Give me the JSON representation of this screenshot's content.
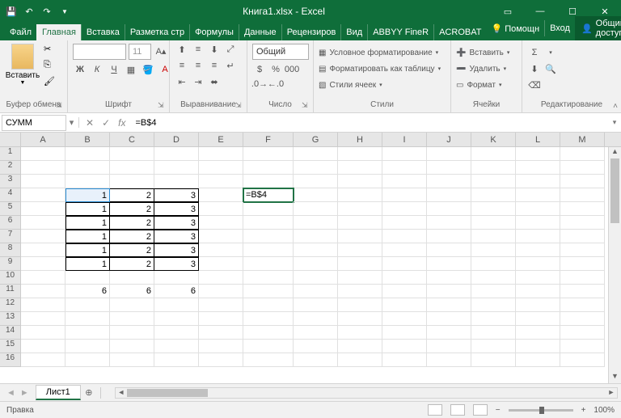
{
  "app": {
    "title": "Книга1.xlsx - Excel"
  },
  "tabs": {
    "file": "Файл",
    "items": [
      "Главная",
      "Вставка",
      "Разметка стр",
      "Формулы",
      "Данные",
      "Рецензиров",
      "Вид",
      "ABBYY FineR",
      "ACROBAT"
    ],
    "help": "Помощн",
    "signin": "Вход",
    "share": "Общий доступ"
  },
  "ribbon": {
    "clipboard": {
      "label": "Буфер обмена",
      "paste": "Вставить"
    },
    "font": {
      "label": "Шрифт",
      "size": "11",
      "bold": "Ж",
      "italic": "К",
      "underline": "Ч"
    },
    "align": {
      "label": "Выравнивание"
    },
    "number": {
      "label": "Число",
      "format": "Общий"
    },
    "styles": {
      "label": "Стили",
      "cond": "Условное форматирование",
      "table": "Форматировать как таблицу",
      "cell": "Стили ячеек"
    },
    "cells": {
      "label": "Ячейки",
      "ins": "Вставить",
      "del": "Удалить",
      "fmt": "Формат"
    },
    "edit": {
      "label": "Редактирование"
    }
  },
  "formula": {
    "name": "СУММ",
    "value": "=B$4"
  },
  "cols": [
    "A",
    "B",
    "C",
    "D",
    "E",
    "F",
    "G",
    "H",
    "I",
    "J",
    "K",
    "L",
    "M"
  ],
  "grid": {
    "B4": "1",
    "C4": "2",
    "D4": "3",
    "F4": "=B$4",
    "B5": "1",
    "C5": "2",
    "D5": "3",
    "B6": "1",
    "C6": "2",
    "D6": "3",
    "B7": "1",
    "C7": "2",
    "D7": "3",
    "B8": "1",
    "C8": "2",
    "D8": "3",
    "B9": "1",
    "C9": "2",
    "D9": "3",
    "B11": "6",
    "C11": "6",
    "D11": "6"
  },
  "sheet": {
    "name": "Лист1"
  },
  "status": {
    "mode": "Правка",
    "zoom": "100%"
  }
}
